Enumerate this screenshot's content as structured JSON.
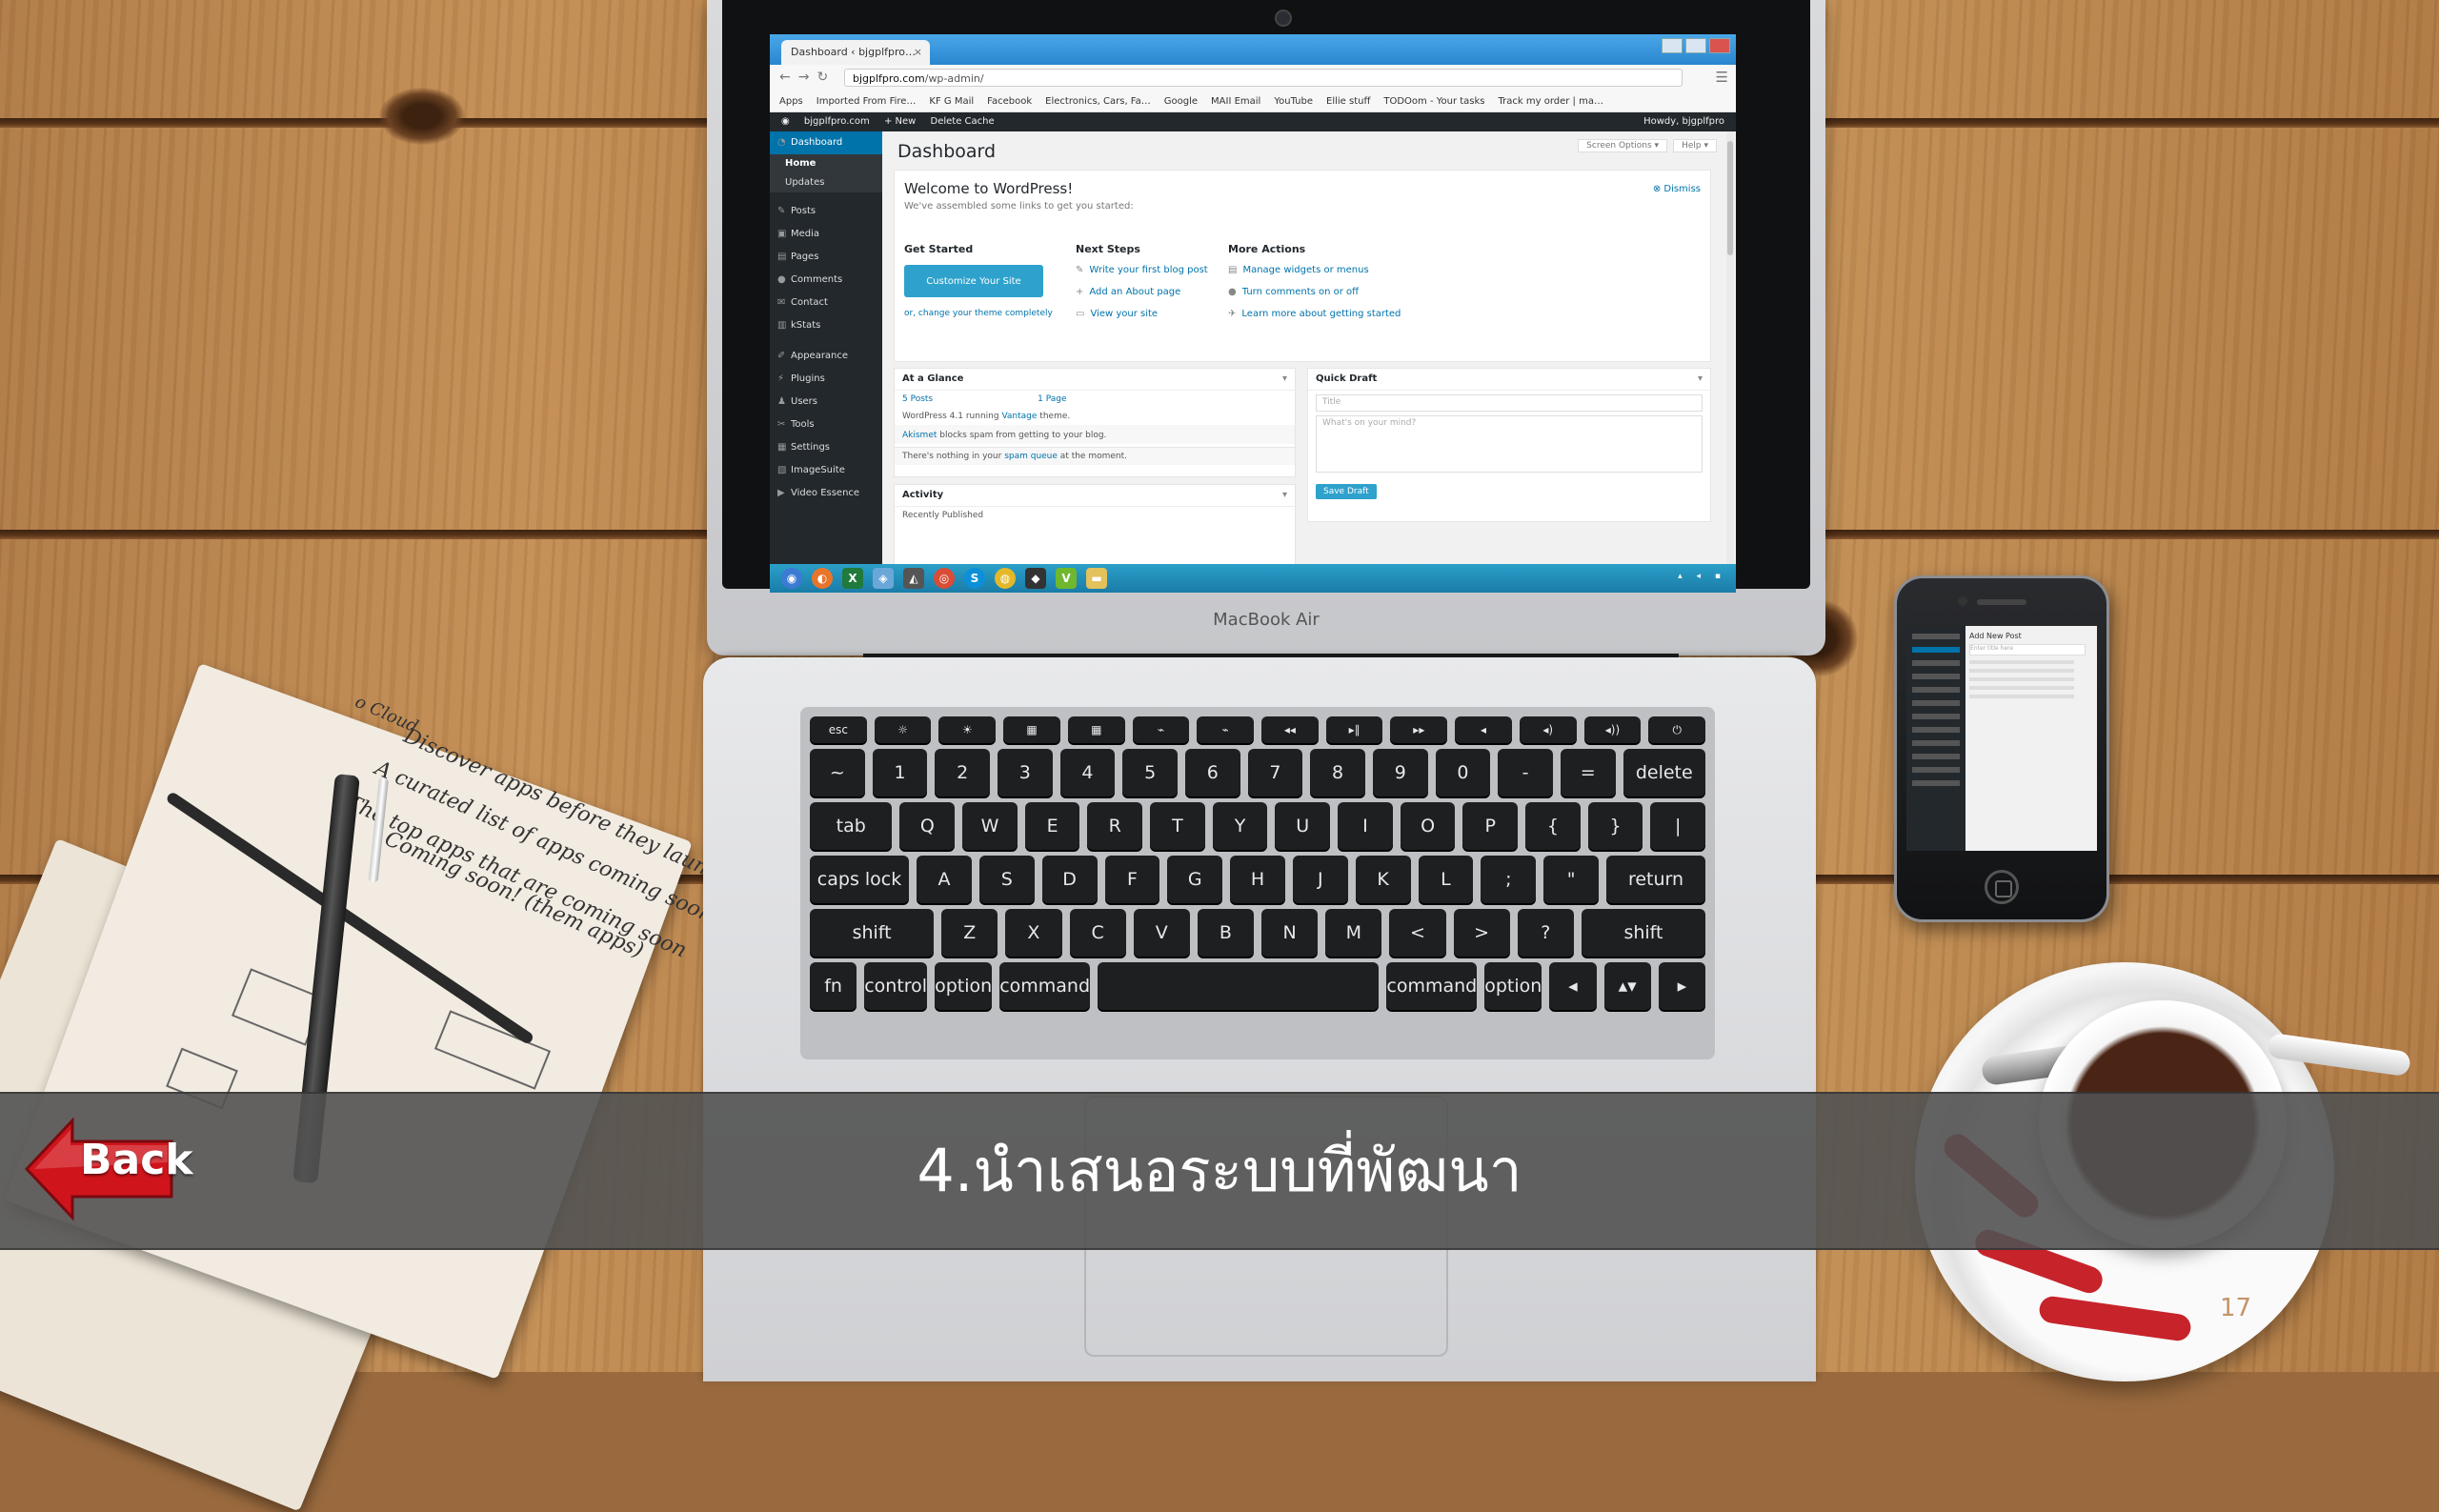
{
  "slide": {
    "title": "4.นำเสนอระบบที่พัฒนา",
    "back_label": "Back",
    "page_number": "17",
    "colors": {
      "band": "#525252",
      "back_arrow": "#d0141c",
      "title_text": "#ffffff"
    }
  },
  "laptop": {
    "brand": "MacBook Air"
  },
  "browser": {
    "tab_title": "Dashboard ‹ bjgplfpro…",
    "url_host": "bjgplfpro.com",
    "url_path": "/wp-admin/",
    "bookmarks": [
      "Apps",
      "Imported From Fire…",
      "KF G Mail",
      "Facebook",
      "Electronics, Cars, Fa…",
      "Google",
      "MAII Email",
      "YouTube",
      "Ellie stuff",
      "TODOom - Your tasks",
      "Track my order | ma…"
    ]
  },
  "wp": {
    "adminbar": {
      "site": "bjgplfpro.com",
      "new": "+ New",
      "cache": "Delete Cache",
      "howdy": "Howdy, bjgplfpro"
    },
    "sidebar": {
      "dashboard": "Dashboard",
      "home": "Home",
      "updates": "Updates",
      "items": [
        "Posts",
        "Media",
        "Pages",
        "Comments",
        "Contact",
        "kStats",
        "Appearance",
        "Plugins",
        "Users",
        "Tools",
        "Settings",
        "ImageSuite",
        "Video Essence"
      ]
    },
    "page_title": "Dashboard",
    "screen_options": "Screen Options ▾",
    "help": "Help ▾",
    "welcome": {
      "heading": "Welcome to WordPress!",
      "subtitle": "We've assembled some links to get you started:",
      "dismiss": "⊗ Dismiss",
      "get_started": "Get Started",
      "customize": "Customize Your Site",
      "change_theme": "or, change your theme completely",
      "next_steps": "Next Steps",
      "next_links": [
        "Write your first blog post",
        "Add an About page",
        "View your site"
      ],
      "more_actions": "More Actions",
      "more_links": [
        "Manage widgets or menus",
        "Turn comments on or off",
        "Learn more about getting started"
      ]
    },
    "glance": {
      "title": "At a Glance",
      "posts": "5 Posts",
      "pages": "1 Page",
      "version_pre": "WordPress 4.1 running ",
      "theme": "Vantage",
      "version_post": " theme.",
      "akismet": "Akismet",
      "akismet_text": " blocks spam from getting to your blog.",
      "spam_text_pre": "There's nothing in your ",
      "spam_link": "spam queue",
      "spam_text_post": " at the moment."
    },
    "activity": {
      "title": "Activity",
      "recent": "Recently Published"
    },
    "quickdraft": {
      "title": "Quick Draft",
      "title_placeholder": "Title",
      "body_placeholder": "What's on your mind?",
      "save": "Save Draft"
    }
  },
  "phone": {
    "heading": "Add New Post",
    "placeholder": "Enter title here"
  },
  "notebook": {
    "lines": [
      "Discover apps before they launch.",
      "A curated list of apps coming soon.",
      "The top apps that are coming soon",
      "Coming soon! (them apps)"
    ],
    "label": "o Cloud"
  }
}
